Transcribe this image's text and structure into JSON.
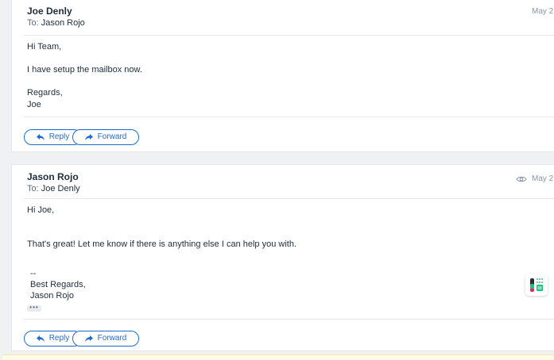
{
  "messages": [
    {
      "sender": "Joe Denly",
      "to_label": "To:",
      "to_name": "Jason Rojo",
      "date": "May 2",
      "body": [
        "Hi Team,",
        "I have setup the mailbox now.",
        "Regards,",
        "Joe"
      ],
      "reply_label": "Reply",
      "forward_label": "Forward"
    },
    {
      "sender": "Jason Rojo",
      "to_label": "To:",
      "to_name": "Joe Denly",
      "date": "May 2",
      "body": [
        "Hi Joe,",
        "That's great! Let me know if there is anything else I can help you with."
      ],
      "signature": [
        "--",
        "Best Regards,",
        "Jason Rojo"
      ],
      "more_label": "•••",
      "reply_label": "Reply",
      "forward_label": "Forward"
    }
  ],
  "colors": {
    "accent": "#1f6bd1",
    "background": "#f0f1f3",
    "widget_green": "#1bc47d",
    "widget_pink": "#e91e63"
  },
  "icons": [
    "reply-icon",
    "forward-icon",
    "eye-icon",
    "widget-icon"
  ]
}
